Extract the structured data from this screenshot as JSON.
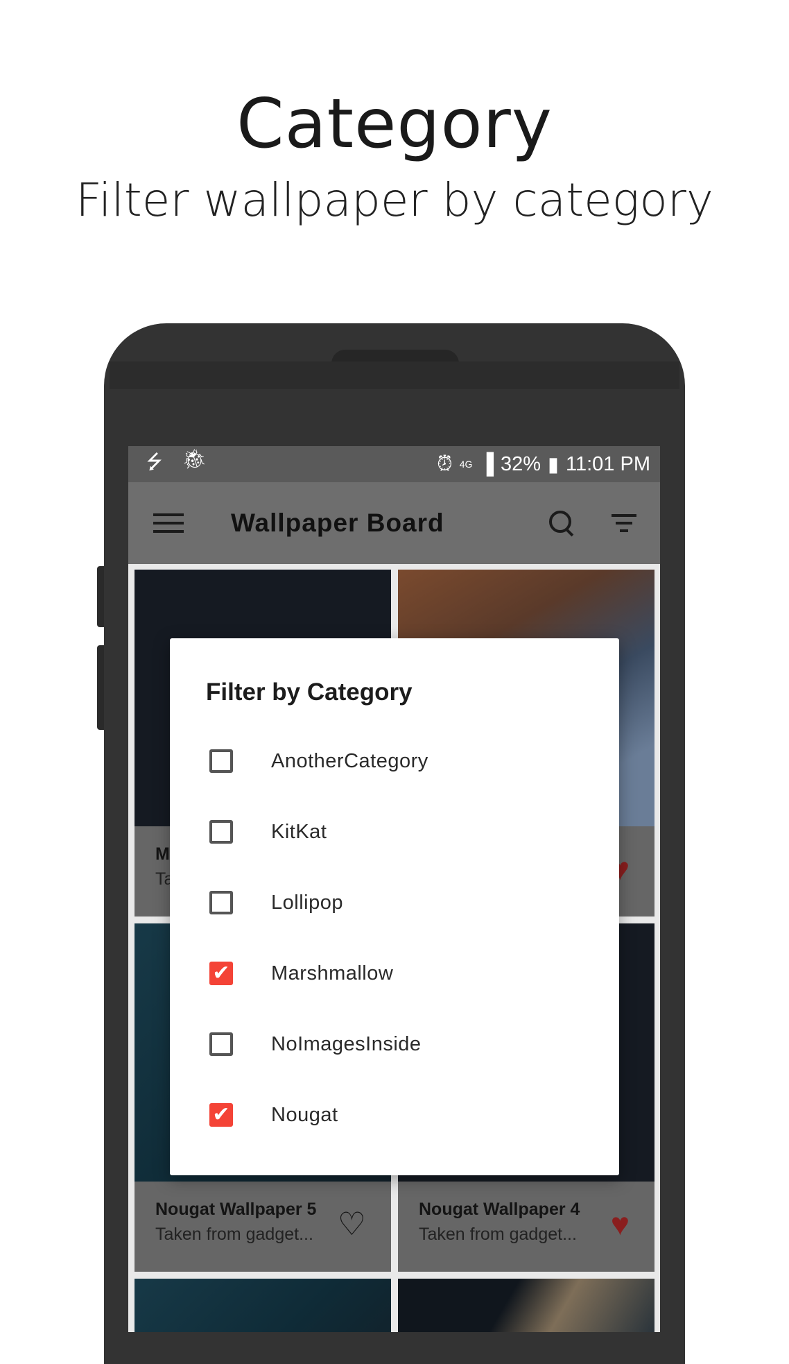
{
  "promo": {
    "title": "Category",
    "subtitle": "Filter wallpaper by category"
  },
  "statusbar": {
    "network": "4G",
    "battery": "32%",
    "time": "11:01 PM"
  },
  "appbar": {
    "title": "Wallpaper Board"
  },
  "cards": [
    {
      "title": "M",
      "subtitle": "Ta",
      "favorite": false
    },
    {
      "title": "",
      "subtitle": "",
      "favorite": true
    },
    {
      "title": "Nougat Wallpaper 5",
      "subtitle": "Taken from gadget...",
      "favorite": false
    },
    {
      "title": "Nougat Wallpaper 4",
      "subtitle": "Taken from gadget...",
      "favorite": true
    }
  ],
  "dialog": {
    "title": "Filter by Category",
    "options": [
      {
        "label": "AnotherCategory",
        "checked": false
      },
      {
        "label": "KitKat",
        "checked": false
      },
      {
        "label": "Lollipop",
        "checked": false
      },
      {
        "label": "Marshmallow",
        "checked": true
      },
      {
        "label": "NoImagesInside",
        "checked": false
      },
      {
        "label": "Nougat",
        "checked": true
      }
    ]
  },
  "colors": {
    "accent": "#f44336",
    "phone": "#333333",
    "appbar_dimmed": "#6e6e6e"
  }
}
